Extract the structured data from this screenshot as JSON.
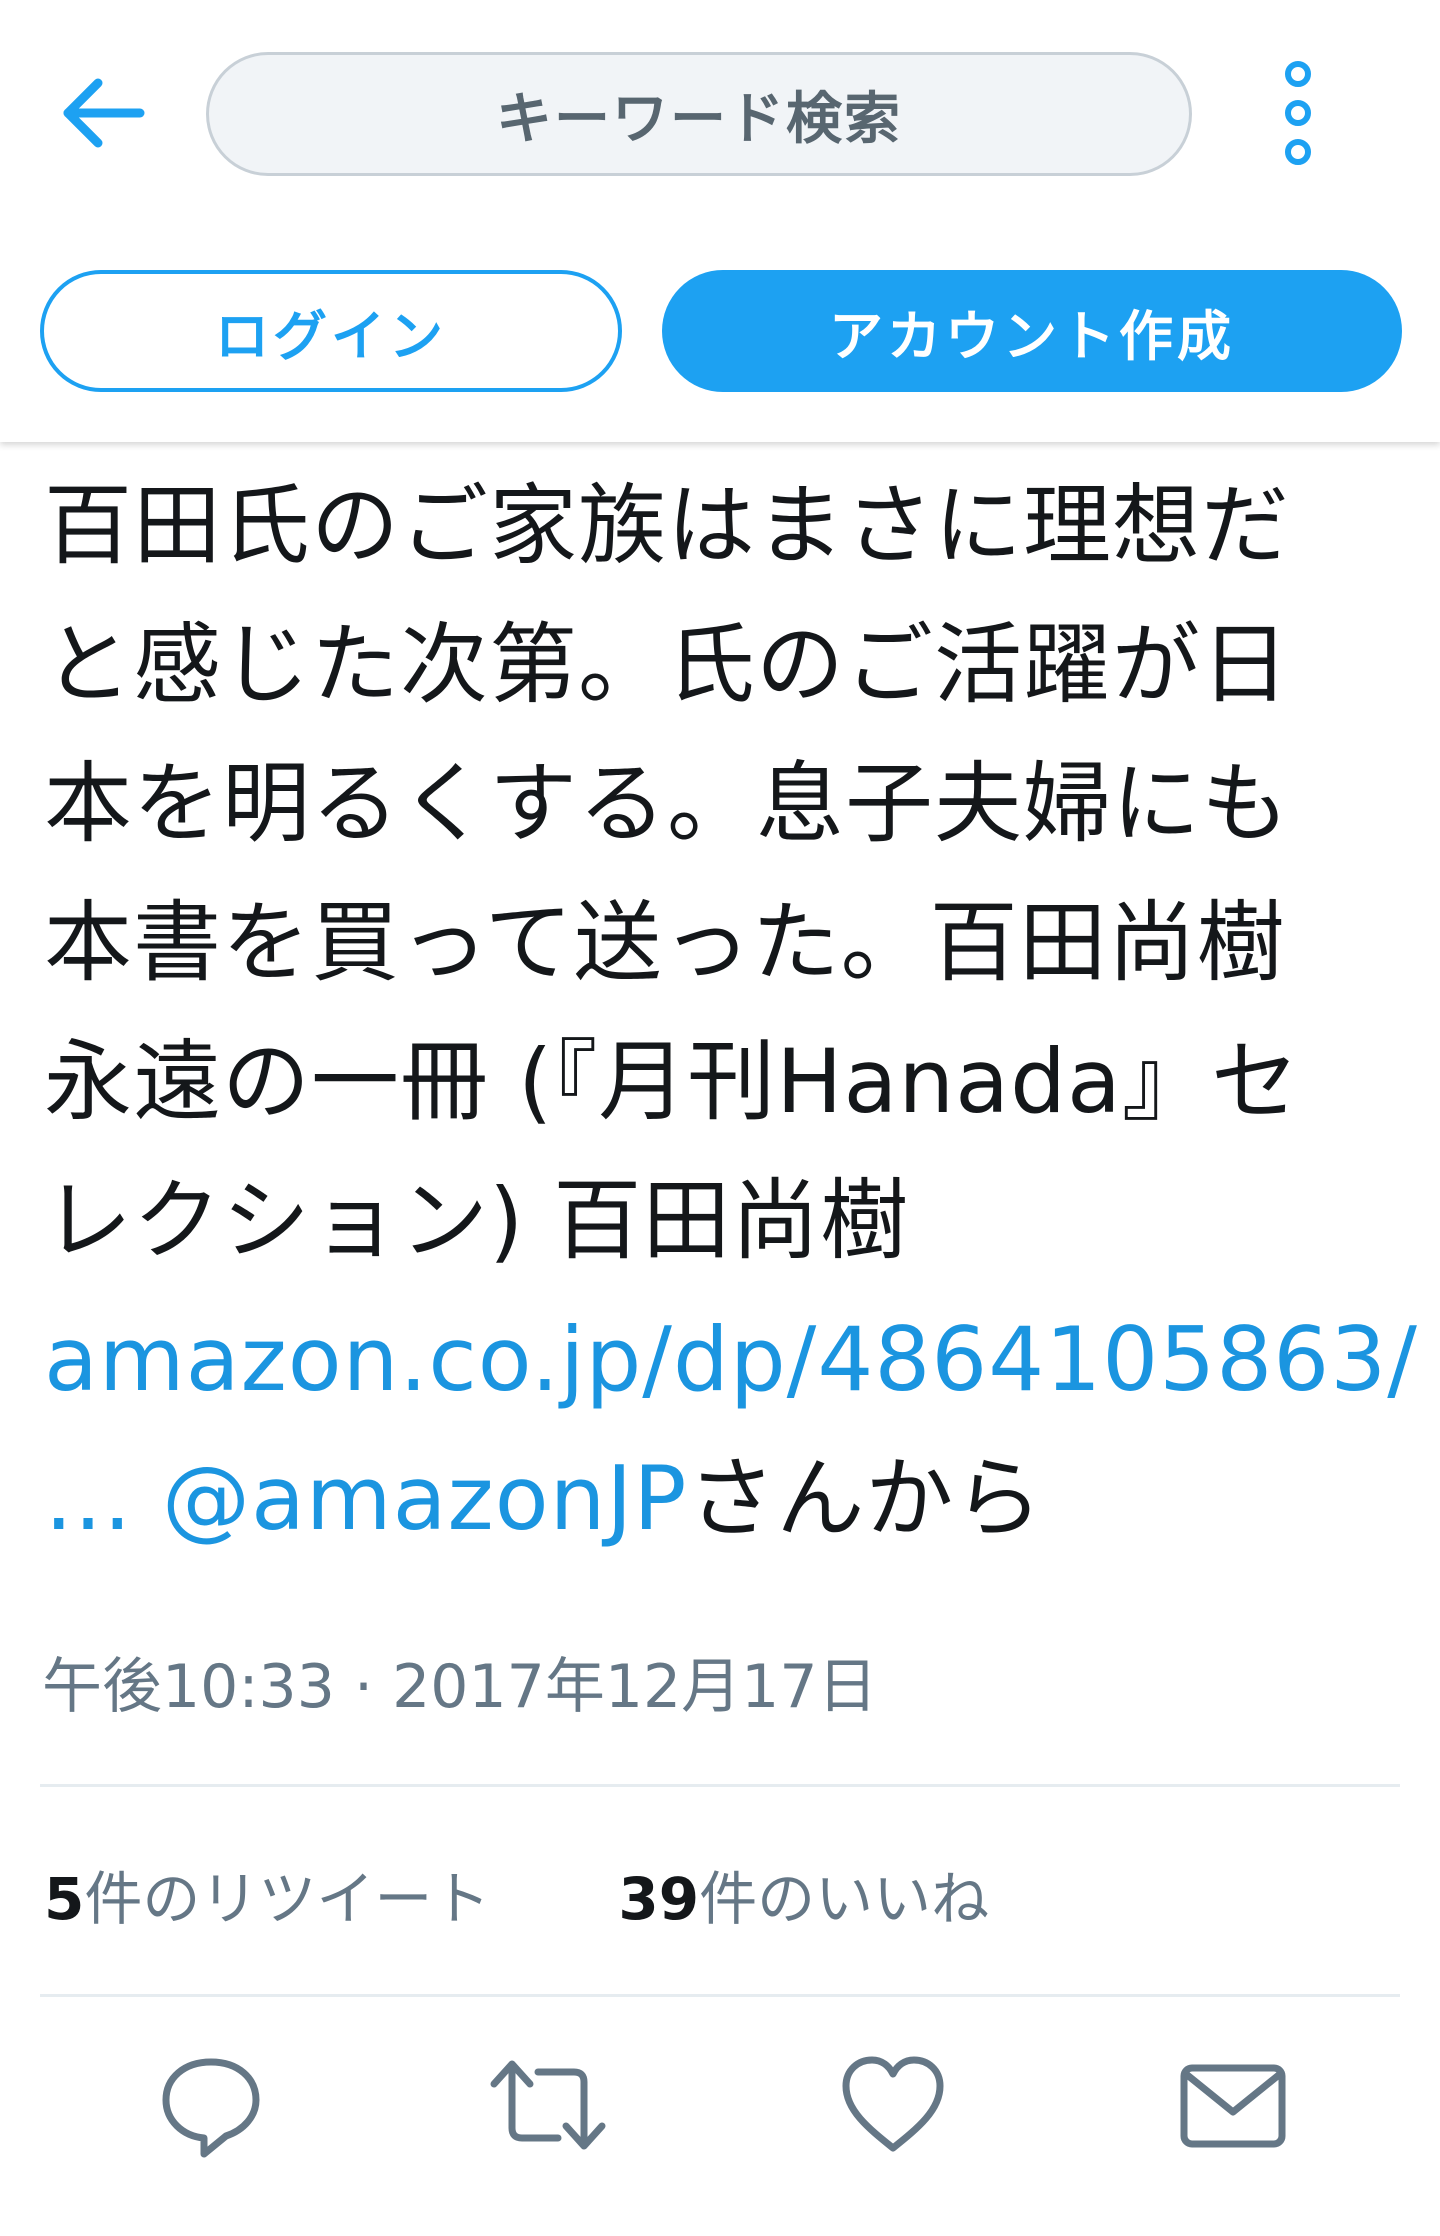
{
  "header": {
    "search_placeholder": "キーワード検索",
    "login_label": "ログイン",
    "signup_label": "アカウント作成"
  },
  "tweet": {
    "lines": [
      "百田氏のご家族はまさに理想だ",
      "と感じた次第。氏のご活躍が日",
      "本を明るくする。息子夫婦にも",
      "本書を買って送った。百田尚樹",
      "永遠の一冊 (『月刊Hanada』セ",
      "レクション)  百田尚樹"
    ],
    "link_url": "amazon.co.jp/dp/4864105863/",
    "link_ellipsis": "…",
    "mention": "@amazonJP",
    "mention_suffix": "さんから",
    "timestamp": "午後10:33 · 2017年12月17日"
  },
  "stats": {
    "retweets_count": "5",
    "retweets_label": "件のリツイート",
    "likes_count": "39",
    "likes_label": "件のいいね"
  },
  "icons": {
    "back": "arrow-left-icon",
    "menu": "more-vertical-icon",
    "reply": "reply-bubble-icon",
    "retweet": "retweet-icon",
    "like": "heart-icon",
    "dm": "envelope-icon"
  },
  "colors": {
    "accent": "#1da1f2",
    "link": "#1b95e0",
    "muted": "#657786",
    "text": "#14171a"
  }
}
